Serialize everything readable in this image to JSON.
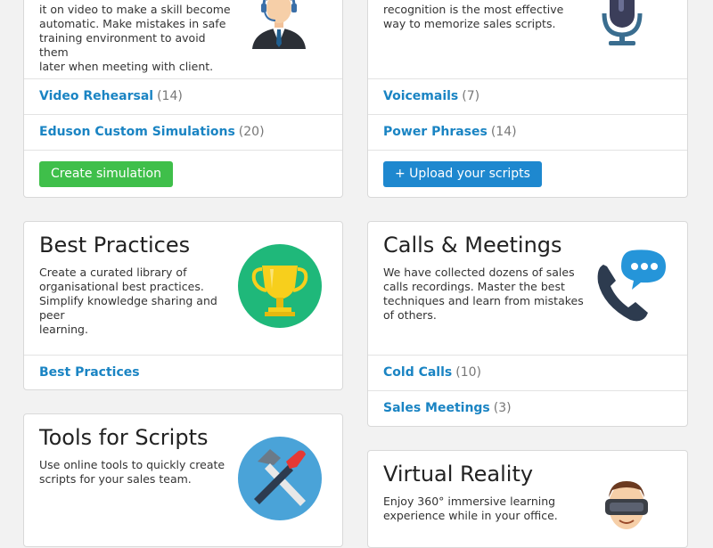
{
  "cards": {
    "rehearsal": {
      "desc_lines": [
        "it on video to make a skill become",
        "automatic. Make mistakes in safe",
        "training environment to avoid them",
        "later when meeting with client."
      ],
      "links": [
        {
          "label": "Video Rehearsal",
          "count": "(14)"
        },
        {
          "label": "Eduson Custom Simulations",
          "count": "(20)"
        }
      ],
      "button": "Create simulation",
      "icon": "support-agent-icon"
    },
    "scripts": {
      "desc_lines": [
        "recognition is the most effective",
        "way to memorize sales scripts."
      ],
      "links": [
        {
          "label": "Voicemails",
          "count": "(7)"
        },
        {
          "label": "Power Phrases",
          "count": "(14)"
        }
      ],
      "button": "+ Upload your scripts",
      "icon": "microphone-icon"
    },
    "best_practices": {
      "title": "Best Practices",
      "desc_lines": [
        "Create a curated library of",
        "organisational best practices.",
        "Simplify knowledge sharing and peer",
        "learning."
      ],
      "links": [
        {
          "label": "Best Practices",
          "count": ""
        }
      ],
      "icon": "trophy-icon"
    },
    "calls": {
      "title": "Calls & Meetings",
      "desc_lines": [
        "We have collected dozens of sales",
        "calls recordings. Master the best",
        "techniques and learn from mistakes",
        "of others."
      ],
      "links": [
        {
          "label": "Cold Calls",
          "count": "(10)"
        },
        {
          "label": "Sales Meetings",
          "count": "(3)"
        }
      ],
      "icon": "phone-chat-icon"
    },
    "tools": {
      "title": "Tools for Scripts",
      "desc_lines": [
        "Use online tools to quickly create",
        "scripts for your sales team."
      ],
      "icon": "hammer-screwdriver-icon"
    },
    "vr": {
      "title": "Virtual Reality",
      "desc_lines": [
        "Enjoy 360° immersive learning",
        "experience while in your office."
      ],
      "icon": "vr-headset-icon"
    }
  },
  "colors": {
    "link": "#1a84c3",
    "green_button": "#3fbf4a",
    "blue_button": "#1e88cf",
    "trophy_bg": "#1fb87a",
    "tools_bg": "#4aa3d8"
  }
}
